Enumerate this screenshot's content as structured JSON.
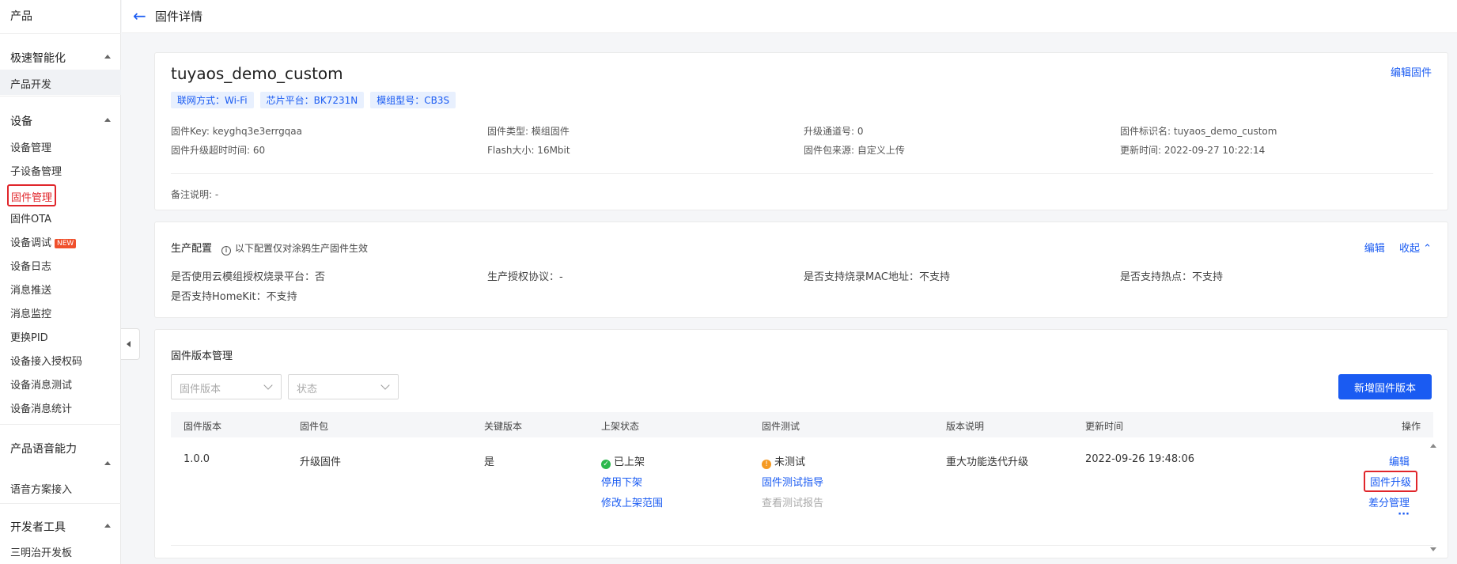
{
  "sidebar": {
    "title": "产品",
    "groups": [
      {
        "label": "极速智能化",
        "items": [
          "产品开发"
        ]
      },
      {
        "label": "设备",
        "items": [
          "设备管理",
          "子设备管理",
          "固件管理",
          "固件OTA",
          "设备调试",
          "设备日志",
          "消息推送",
          "消息监控",
          "更换PID",
          "设备接入授权码",
          "设备消息测试",
          "设备消息统计"
        ]
      },
      {
        "label": "产品语音能力",
        "items": [
          "语音方案接入"
        ]
      },
      {
        "label": "开发者工具",
        "items": [
          "三明治开发板"
        ]
      }
    ],
    "new_badge": "NEW"
  },
  "header": {
    "title": "固件详情"
  },
  "firmware": {
    "name": "tuyaos_demo_custom",
    "edit_label": "编辑固件",
    "tags": [
      "联网方式：Wi-Fi",
      "芯片平台：BK7231N",
      "模组型号：CB3S"
    ],
    "info": {
      "key": "固件Key: keyghq3e3errgqaa",
      "type": "固件类型: 模组固件",
      "channel": "升级通道号: 0",
      "identifier": "固件标识名: tuyaos_demo_custom",
      "timeout": "固件升级超时时间: 60",
      "flash": "Flash大小: 16Mbit",
      "source": "固件包来源: 自定义上传",
      "updated": "更新时间: 2022-09-27 10:22:14"
    },
    "remark": "备注说明: -"
  },
  "production": {
    "title": "生产配置",
    "hint": "以下配置仅对涂鸦生产固件生效",
    "edit_label": "编辑",
    "collapse_label": "收起",
    "items": {
      "cloud_auth": "是否使用云模组授权烧录平台：否",
      "protocol": "生产授权协议：-",
      "mac": "是否支持烧录MAC地址：不支持",
      "hotspot": "是否支持热点：不支持",
      "homekit": "是否支持HomeKit：不支持"
    }
  },
  "versions": {
    "title": "固件版本管理",
    "filter_version_placeholder": "固件版本",
    "filter_status_placeholder": "状态",
    "add_button": "新增固件版本",
    "columns": [
      "固件版本",
      "固件包",
      "关键版本",
      "上架状态",
      "固件测试",
      "版本说明",
      "更新时间",
      "操作"
    ],
    "rows": [
      {
        "version": "1.0.0",
        "package": "升级固件",
        "key_version": "是",
        "status": "已上架",
        "status_actions": [
          "停用下架",
          "修改上架范围"
        ],
        "test_status": "未测试",
        "test_actions": [
          "固件测试指导",
          "查看测试报告"
        ],
        "description": "重大功能迭代升级",
        "updated": "2022-09-26 19:48:06",
        "ops": [
          "编辑",
          "固件升级",
          "差分管理",
          "···"
        ]
      }
    ]
  }
}
